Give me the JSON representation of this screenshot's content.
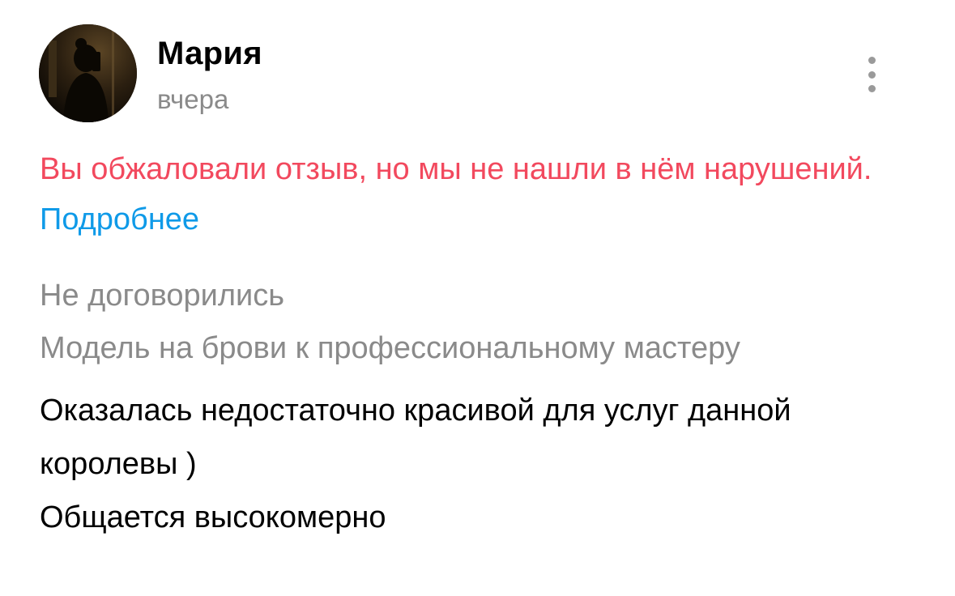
{
  "review": {
    "author": {
      "name": "Мария",
      "avatar_icon": "user-avatar-photo"
    },
    "date": "вчера",
    "menu_icon": "more-vertical-icon",
    "appeal": {
      "message": "Вы обжаловали отзыв, но мы не нашли в нём нарушений.",
      "link_label": "Подробнее",
      "message_color": "#f2495e",
      "link_color": "#0f9ae8"
    },
    "deal_status": "Не договорились",
    "service": "Модель на брови к профессиональному мастеру",
    "text_lines": [
      "Оказалась недостаточно красивой для услуг данной королевы )",
      "Общается высокомерно"
    ]
  }
}
